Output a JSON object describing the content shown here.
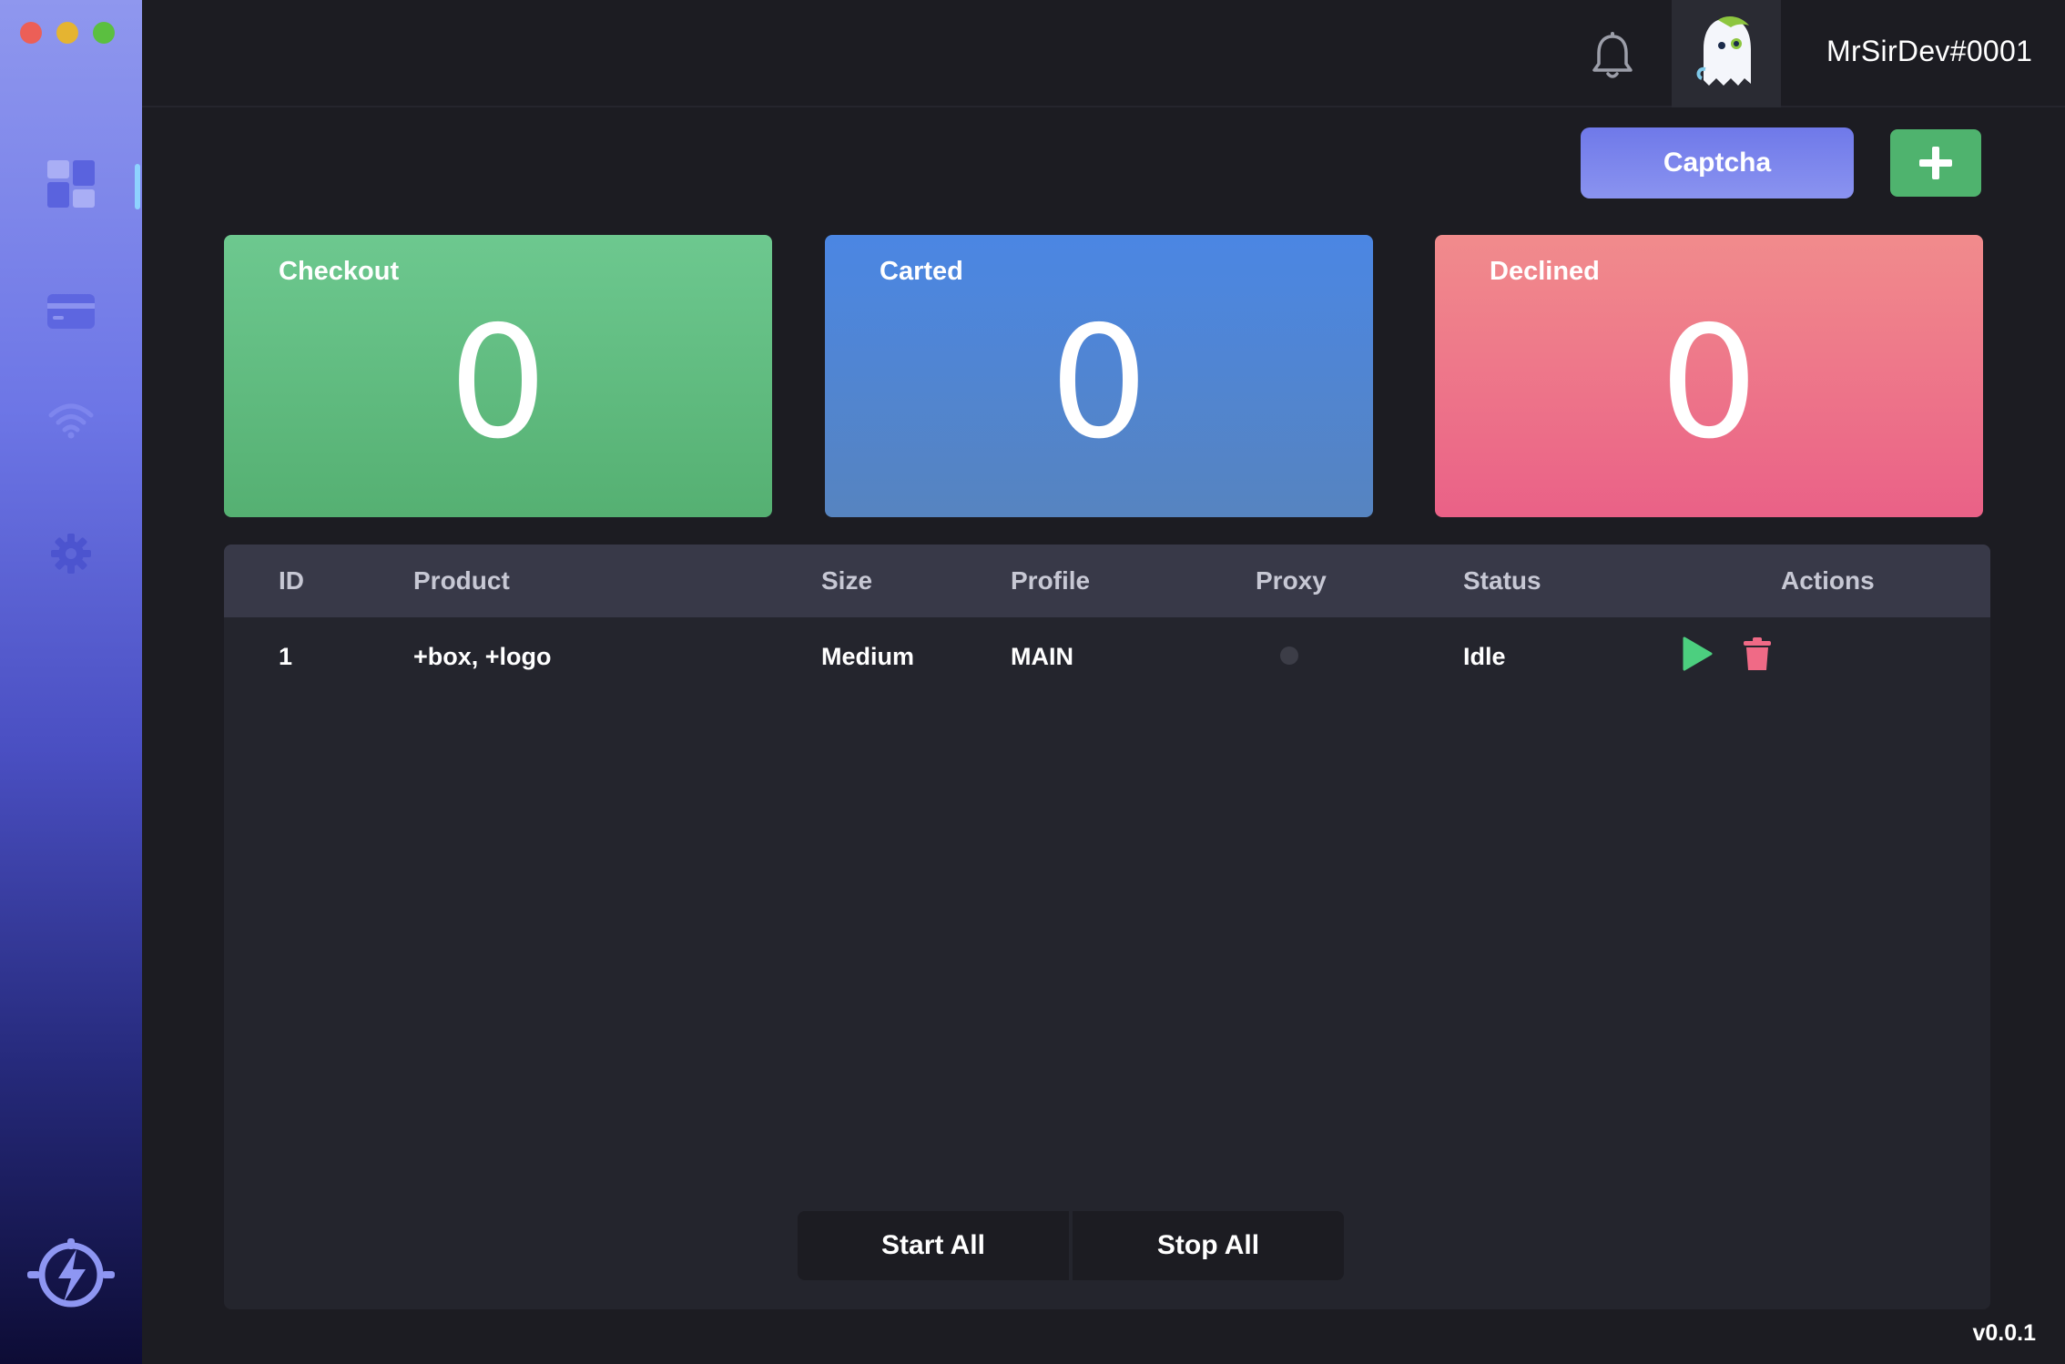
{
  "window": {
    "controls": [
      "close",
      "minimize",
      "maximize"
    ]
  },
  "sidebar": {
    "items": [
      {
        "name": "dashboard-icon",
        "active": true
      },
      {
        "name": "card-icon",
        "active": false
      },
      {
        "name": "wifi-icon",
        "active": false
      },
      {
        "name": "gear-icon",
        "active": false
      }
    ],
    "logo": "bolt-logo-icon"
  },
  "header": {
    "notification_icon": "bell-icon",
    "avatar_icon": "ghost-avatar-icon",
    "username": "MrSirDev#0001"
  },
  "toolbar": {
    "captcha_label": "Captcha",
    "add_icon": "plus-icon"
  },
  "stats": {
    "checkout": {
      "label": "Checkout",
      "value": "0"
    },
    "carted": {
      "label": "Carted",
      "value": "0"
    },
    "declined": {
      "label": "Declined",
      "value": "0"
    }
  },
  "table": {
    "columns": {
      "id": "ID",
      "product": "Product",
      "size": "Size",
      "profile": "Profile",
      "proxy": "Proxy",
      "status": "Status",
      "actions": "Actions"
    },
    "rows": [
      {
        "id": "1",
        "product": "+box, +logo",
        "size": "Medium",
        "profile": "MAIN",
        "proxy": "",
        "status": "Idle"
      }
    ]
  },
  "bulk": {
    "start_label": "Start All",
    "stop_label": "Stop All"
  },
  "footer": {
    "version": "v0.0.1"
  },
  "colors": {
    "checkout": "#5dbb7e",
    "carted": "#4b86e3",
    "declined": "#ee7589",
    "add_button": "#4fb36e",
    "captcha": "#7b84ed"
  }
}
